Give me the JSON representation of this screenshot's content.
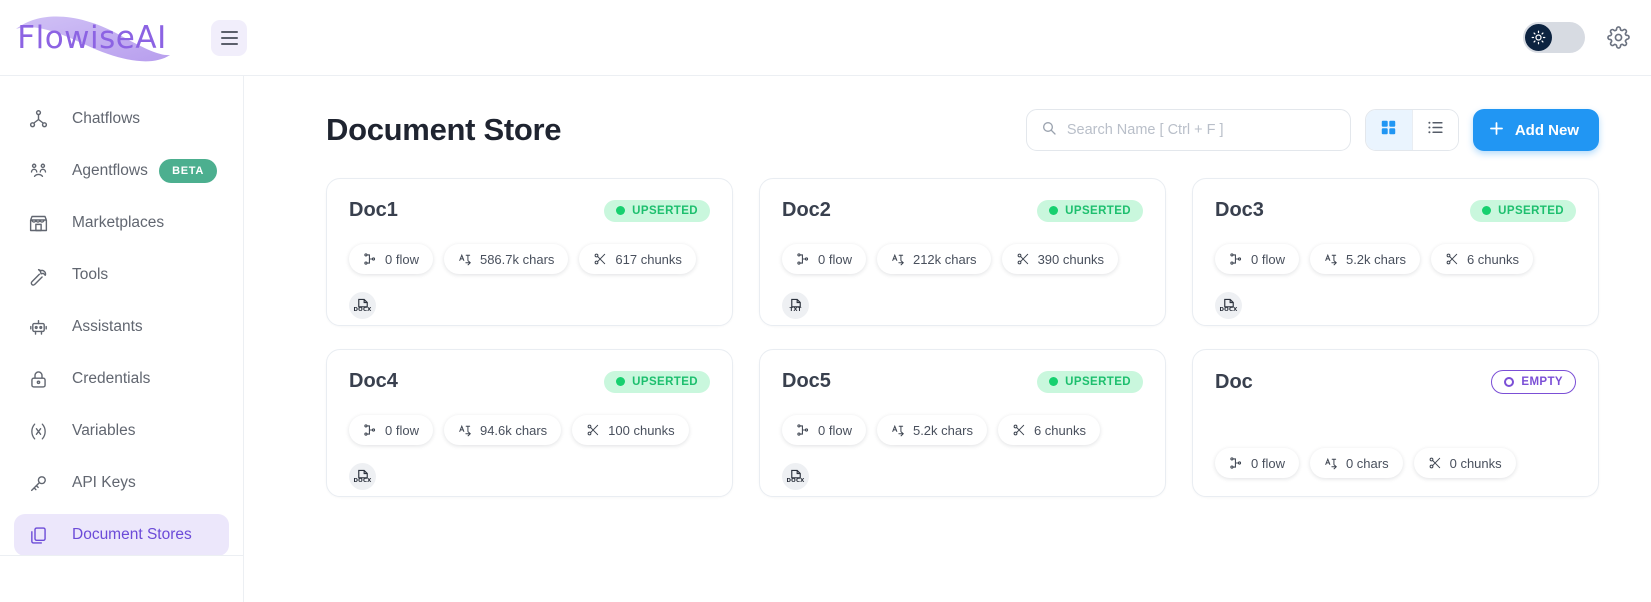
{
  "brand": {
    "name": "FlowiseAI",
    "accent": "#8c63e3"
  },
  "topbar": {
    "menu_icon": "hamburger-menu-icon",
    "theme_toggle_icon": "sun-icon",
    "settings_icon": "gear-icon"
  },
  "sidebar": {
    "items": [
      {
        "label": "Chatflows",
        "icon": "chatflow-icon",
        "active": false,
        "badge": null
      },
      {
        "label": "Agentflows",
        "icon": "agentflow-icon",
        "active": false,
        "badge": "BETA"
      },
      {
        "label": "Marketplaces",
        "icon": "marketplace-icon",
        "active": false,
        "badge": null
      },
      {
        "label": "Tools",
        "icon": "wrench-icon",
        "active": false,
        "badge": null
      },
      {
        "label": "Assistants",
        "icon": "robot-icon",
        "active": false,
        "badge": null
      },
      {
        "label": "Credentials",
        "icon": "lock-icon",
        "active": false,
        "badge": null
      },
      {
        "label": "Variables",
        "icon": "variable-icon",
        "active": false,
        "badge": null
      },
      {
        "label": "API Keys",
        "icon": "key-icon",
        "active": false,
        "badge": null
      },
      {
        "label": "Document Stores",
        "icon": "documents-icon",
        "active": true,
        "badge": null
      }
    ]
  },
  "main": {
    "title": "Document Store",
    "search": {
      "placeholder": "Search Name [ Ctrl + F ]",
      "value": "",
      "icon": "search-icon"
    },
    "views": [
      {
        "name": "grid-view",
        "icon": "grid-icon",
        "active": true
      },
      {
        "name": "list-view",
        "icon": "list-icon",
        "active": false
      }
    ],
    "add_button": {
      "label": "Add New",
      "icon": "plus-icon",
      "color": "#2196f3"
    }
  },
  "cards": [
    {
      "title": "Doc1",
      "status": {
        "label": "UPSERTED",
        "type": "upserted"
      },
      "flows": "0 flow",
      "chars": "586.7k chars",
      "chunks": "617 chunks",
      "file_type": "DOCX"
    },
    {
      "title": "Doc2",
      "status": {
        "label": "UPSERTED",
        "type": "upserted"
      },
      "flows": "0 flow",
      "chars": "212k chars",
      "chunks": "390 chunks",
      "file_type": "TXT"
    },
    {
      "title": "Doc3",
      "status": {
        "label": "UPSERTED",
        "type": "upserted"
      },
      "flows": "0 flow",
      "chars": "5.2k chars",
      "chunks": "6 chunks",
      "file_type": "DOCX"
    },
    {
      "title": "Doc4",
      "status": {
        "label": "UPSERTED",
        "type": "upserted"
      },
      "flows": "0 flow",
      "chars": "94.6k chars",
      "chunks": "100 chunks",
      "file_type": "DOCX"
    },
    {
      "title": "Doc5",
      "status": {
        "label": "UPSERTED",
        "type": "upserted"
      },
      "flows": "0 flow",
      "chars": "5.2k chars",
      "chunks": "6 chunks",
      "file_type": "DOCX"
    },
    {
      "title": "Doc",
      "status": {
        "label": "EMPTY",
        "type": "empty"
      },
      "flows": "0 flow",
      "chars": "0 chars",
      "chunks": "0 chunks",
      "file_type": null
    }
  ]
}
